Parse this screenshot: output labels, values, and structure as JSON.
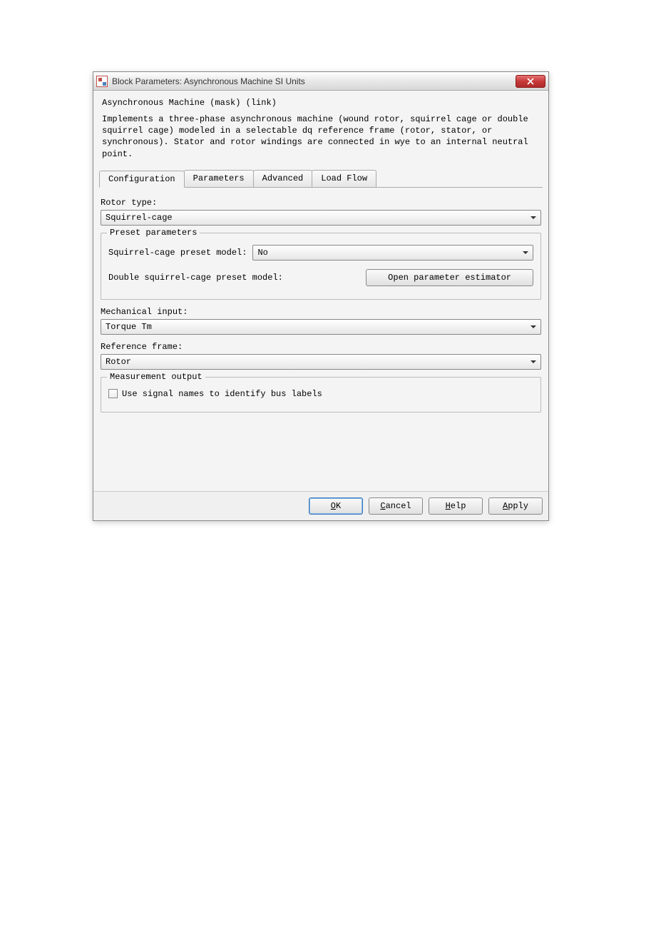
{
  "window": {
    "title": "Block Parameters: Asynchronous Machine SI Units"
  },
  "header": {
    "mask_line": "Asynchronous Machine (mask) (link)",
    "description": "Implements a three-phase asynchronous machine (wound rotor, squirrel cage or double squirrel cage) modeled in a selectable dq reference frame (rotor, stator, or synchronous). Stator and rotor windings are connected in wye to an internal neutral point."
  },
  "tabs": [
    {
      "label": "Configuration",
      "active": true
    },
    {
      "label": "Parameters",
      "active": false
    },
    {
      "label": "Advanced",
      "active": false
    },
    {
      "label": "Load Flow",
      "active": false
    }
  ],
  "config": {
    "rotor_type_label": "Rotor type:",
    "rotor_type_value": "Squirrel-cage",
    "preset_group_label": "Preset parameters",
    "sc_preset_label": "Squirrel-cage preset model:",
    "sc_preset_value": "No",
    "dsc_preset_label": "Double squirrel-cage preset model:",
    "open_estimator_label": "Open parameter estimator",
    "mech_input_label": "Mechanical input:",
    "mech_input_value": "Torque Tm",
    "ref_frame_label": "Reference frame:",
    "ref_frame_value": "Rotor",
    "measurement_group_label": "Measurement output",
    "signal_names_label": "Use signal names to identify bus labels"
  },
  "buttons": {
    "ok": "OK",
    "cancel": "Cancel",
    "help": "Help",
    "apply": "Apply"
  }
}
